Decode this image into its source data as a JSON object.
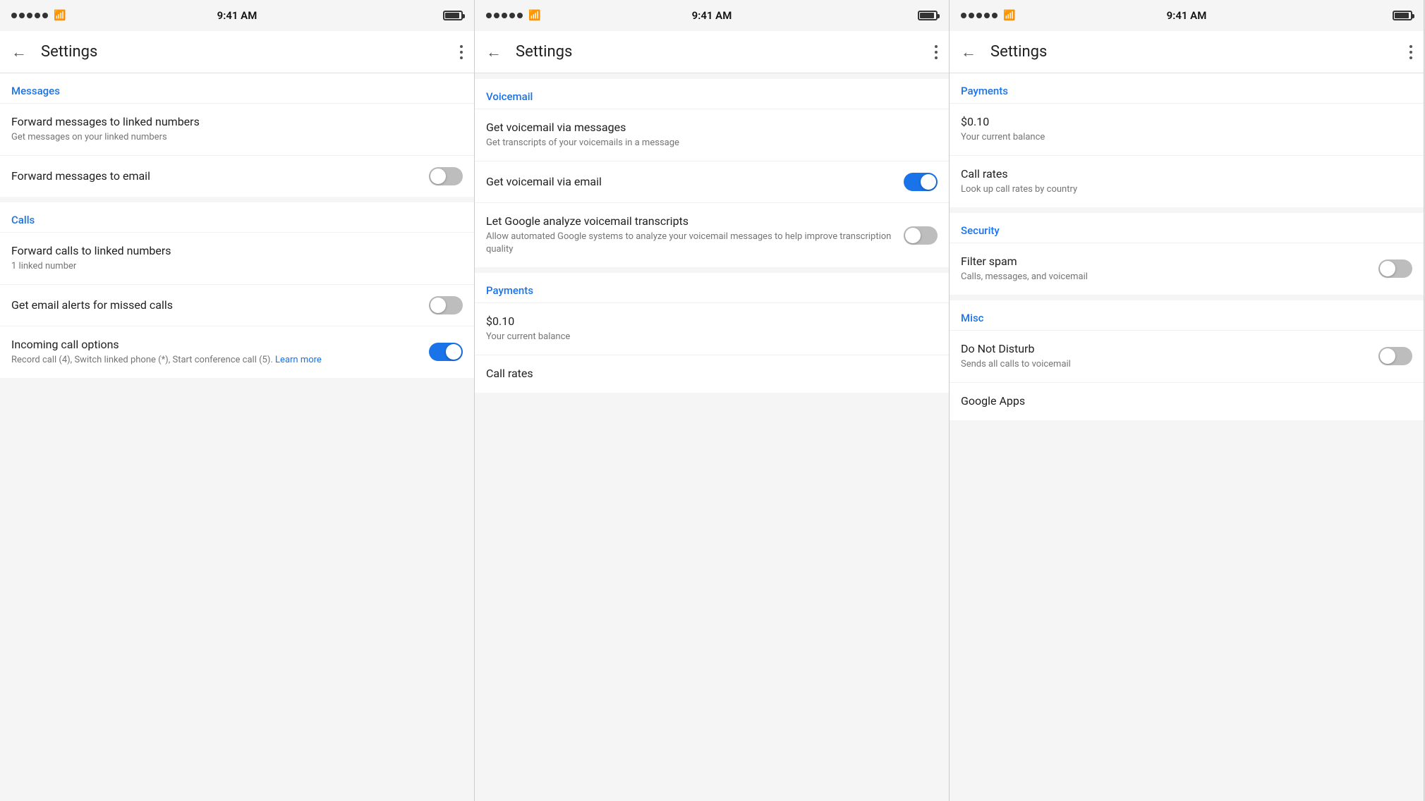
{
  "panels": [
    {
      "id": "panel-left",
      "statusBar": {
        "time": "9:41 AM"
      },
      "appBar": {
        "title": "Settings",
        "backLabel": "←",
        "moreLabel": "⋮"
      },
      "sections": [
        {
          "id": "messages-section",
          "header": "Messages",
          "items": [
            {
              "id": "forward-to-linked",
              "title": "Forward messages to linked numbers",
              "subtitle": "Get messages on your linked numbers",
              "toggle": null,
              "hasToggle": false
            },
            {
              "id": "forward-to-email",
              "title": "Forward messages to email",
              "subtitle": "",
              "toggle": "off",
              "hasToggle": true
            }
          ]
        },
        {
          "id": "calls-section",
          "header": "Calls",
          "items": [
            {
              "id": "forward-calls-linked",
              "title": "Forward calls to linked numbers",
              "subtitle": "1 linked number",
              "toggle": null,
              "hasToggle": false
            },
            {
              "id": "email-alerts-missed",
              "title": "Get email alerts for missed calls",
              "subtitle": "",
              "toggle": "off",
              "hasToggle": true
            },
            {
              "id": "incoming-call-options",
              "title": "Incoming call options",
              "subtitle": "Record call (4), Switch linked phone (*), Start conference call (5).",
              "subtitleLink": "Learn more",
              "toggle": "on",
              "hasToggle": true
            }
          ]
        }
      ]
    },
    {
      "id": "panel-middle",
      "statusBar": {
        "time": "9:41 AM"
      },
      "appBar": {
        "title": "Settings",
        "backLabel": "←",
        "moreLabel": "⋮"
      },
      "sections": [
        {
          "id": "voicemail-section",
          "header": "Voicemail",
          "items": [
            {
              "id": "voicemail-via-messages",
              "title": "Get voicemail via messages",
              "subtitle": "Get transcripts of your voicemails in a message",
              "toggle": null,
              "hasToggle": false
            },
            {
              "id": "voicemail-via-email",
              "title": "Get voicemail via email",
              "subtitle": "",
              "toggle": "on",
              "hasToggle": true
            },
            {
              "id": "google-analyze",
              "title": "Let Google analyze voicemail transcripts",
              "subtitle": "Allow automated Google systems to analyze your voicemail messages to help improve transcription quality",
              "toggle": "off",
              "hasToggle": true
            }
          ]
        },
        {
          "id": "payments-section-middle",
          "header": "Payments",
          "items": [
            {
              "id": "current-balance-mid",
              "title": "$0.10",
              "subtitle": "Your current balance",
              "toggle": null,
              "hasToggle": false
            },
            {
              "id": "call-rates-mid",
              "title": "Call rates",
              "subtitle": "",
              "toggle": null,
              "hasToggle": false
            }
          ]
        }
      ]
    },
    {
      "id": "panel-right",
      "statusBar": {
        "time": "9:41 AM"
      },
      "appBar": {
        "title": "Settings",
        "backLabel": "←",
        "moreLabel": "⋮"
      },
      "sections": [
        {
          "id": "payments-section-right",
          "header": "Payments",
          "items": [
            {
              "id": "current-balance-right",
              "title": "$0.10",
              "subtitle": "Your current balance",
              "toggle": null,
              "hasToggle": false
            },
            {
              "id": "call-rates-right",
              "title": "Call rates",
              "subtitle": "Look up call rates by country",
              "toggle": null,
              "hasToggle": false
            }
          ]
        },
        {
          "id": "security-section",
          "header": "Security",
          "items": [
            {
              "id": "filter-spam",
              "title": "Filter spam",
              "subtitle": "Calls, messages, and voicemail",
              "toggle": "off",
              "hasToggle": true
            }
          ]
        },
        {
          "id": "misc-section",
          "header": "Misc",
          "items": [
            {
              "id": "do-not-disturb",
              "title": "Do Not Disturb",
              "subtitle": "Sends all calls to voicemail",
              "toggle": "off",
              "hasToggle": true
            },
            {
              "id": "google-apps",
              "title": "Google Apps",
              "subtitle": "",
              "toggle": null,
              "hasToggle": false
            }
          ]
        }
      ]
    }
  ],
  "labels": {
    "back": "←",
    "more": "⋮",
    "learn_more": "Learn more"
  }
}
